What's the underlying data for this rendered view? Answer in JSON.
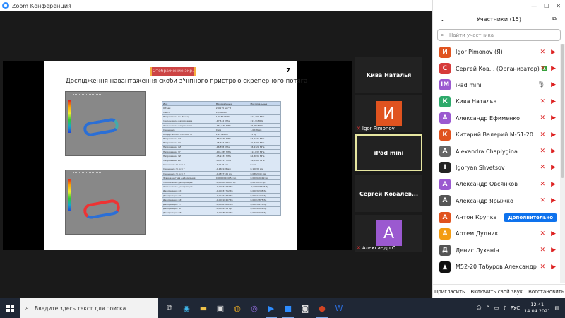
{
  "window": {
    "title": "Zoom Конференция"
  },
  "slide": {
    "title": "Дослідження навантаження скоби з'чіпного пристрою скреперного потяга",
    "page_number": "7",
    "share_badge": "Отображение экр.",
    "table_header": [
      "Имя",
      "Минимальные",
      "Максимальные"
    ],
    "table_rows": [
      [
        "Объем",
        "230175 мм^3",
        ""
      ],
      [
        "Масса",
        "18,0636 кг",
        ""
      ],
      [
        "Напряжение по Мизесу",
        "1,26341 МПа",
        "217,792 МПа"
      ],
      [
        "1-е основное напряжение",
        "-17,542 МПа",
        "213,91 МПа"
      ],
      [
        "3-е основное напряжение",
        "-164,576 МПа",
        "26,951 МПа"
      ],
      [
        "Смещение",
        "0 мм",
        "1,0248 мм"
      ],
      [
        "Коэфф. запаса прочности",
        "1,14798 бр",
        "15 бр"
      ],
      [
        "Напряжение XX",
        "-86,9845 МПа",
        "84,2475 МПа"
      ],
      [
        "Напряжение XY",
        "-25,687 МПа",
        "30,7792 МПа"
      ],
      [
        "Напряжение XZ",
        "-16,898 МПа",
        "18,4124 МПа"
      ],
      [
        "Напряжение YY",
        "-145,285 МПа",
        "114,032 МПа"
      ],
      [
        "Напряжение YZ",
        "-75,9333 МПа",
        "62,8036 МПа"
      ],
      [
        "Напряжение ZZ",
        "-84,3211 МПа",
        "94,5465 МПа"
      ],
      [
        "Смещение по оси X",
        "-1,0136 мм",
        "0 мм"
      ],
      [
        "Смещение по оси Y",
        "-0,160148 мм",
        "0,10038 мм"
      ],
      [
        "Смещение по оси Z",
        "-0,0897726 мм",
        "0,0882043 мм"
      ],
      [
        "Эквивалентная деформация",
        "0,00000444053 бр",
        "0,000959419 бр"
      ],
      [
        "1-я основная деформация",
        "-0,0000031687 бр",
        "0,0010535 бр"
      ],
      [
        "3-я основная деформация",
        "-0,00074287 бр",
        "-0,000008676 бр"
      ],
      [
        "Деформация XX",
        "-0,00031752 бр",
        "0,00036308 бр"
      ],
      [
        "Деформация XY",
        "-0,00167777 бр",
        "0,00021469 бр"
      ],
      [
        "Деформация XZ",
        "-0,00016467 бр",
        "0,00012875 бр"
      ],
      [
        "Деформация YY",
        "-0,00061602 бр",
        "0,00056216 бр"
      ],
      [
        "Деформация YZ",
        "-0,0004939 бр",
        "0,00040901 бр"
      ],
      [
        "Деформация ZZ",
        "-0,00035204 бр",
        "0,00036097 бр"
      ]
    ]
  },
  "tiles": [
    {
      "type": "name",
      "name": "Кива Наталья"
    },
    {
      "type": "avatar",
      "letter": "И",
      "color": "#e0531f",
      "caption": "Igor Pimonov"
    },
    {
      "type": "name",
      "name": "iPad mini",
      "selected": true
    },
    {
      "type": "name",
      "name": "Сергей  Ковалев..."
    },
    {
      "type": "avatar",
      "letter": "А",
      "color": "#9b59d0",
      "caption": "Александр О..."
    }
  ],
  "participants": {
    "header": "Участники (15)",
    "search_placeholder": "Найти участника",
    "more_button": "Дополнительно",
    "list": [
      {
        "letter": "И",
        "color": "#e0531f",
        "name": "Igor Pimonov (Я)",
        "muted": true,
        "video_off": true
      },
      {
        "letter": "С",
        "color": "#d63b3b",
        "name": "Сергей Ков... (Организатор)",
        "host": true,
        "muted": true,
        "video_off": true
      },
      {
        "letter": "IM",
        "color": "#9b59d0",
        "name": "iPad mini",
        "mic_on": true,
        "video_off": true
      },
      {
        "letter": "К",
        "color": "#2eaa6b",
        "name": "Кива Наталья",
        "muted": true,
        "video_off": true
      },
      {
        "letter": "А",
        "color": "#9b59d0",
        "name": "Александр Ефименко",
        "muted": true,
        "video_off": true
      },
      {
        "letter": "К",
        "color": "#e0531f",
        "name": "Китарий Валерий М-51-20",
        "muted": true,
        "video_off": true
      },
      {
        "letter": "A",
        "color": "#666666",
        "name": "Alexandra Chaplygina",
        "muted": true,
        "video_off": true
      },
      {
        "letter": "I",
        "color": "#222222",
        "name": "Igoryan Shvetsov",
        "muted": true,
        "video_off": true
      },
      {
        "letter": "А",
        "color": "#9b59d0",
        "name": "Александр Овсянков",
        "muted": true,
        "video_off": true
      },
      {
        "letter": "А",
        "color": "#555555",
        "name": "Александр Ярыжко",
        "muted": true,
        "video_off": true
      },
      {
        "letter": "А",
        "color": "#e0531f",
        "name": "Антон Крупка",
        "more": true
      },
      {
        "letter": "А",
        "color": "#f39c12",
        "name": "Артем Дудник",
        "muted": true,
        "video_off": true
      },
      {
        "letter": "Д",
        "color": "#555555",
        "name": "Денис Луханін",
        "muted": true,
        "video_off": true
      },
      {
        "letter": "▲",
        "color": "#111111",
        "name": "М52-20 Табуров Александр",
        "muted": true,
        "video_off": true
      }
    ],
    "bottom": [
      "Пригласить",
      "Включить свой звук",
      "Восстановить"
    ]
  },
  "taskbar": {
    "search_placeholder": "Введите здесь текст для поиска",
    "lang": "РУС",
    "time": "12:41",
    "date": "14.04.2021"
  }
}
